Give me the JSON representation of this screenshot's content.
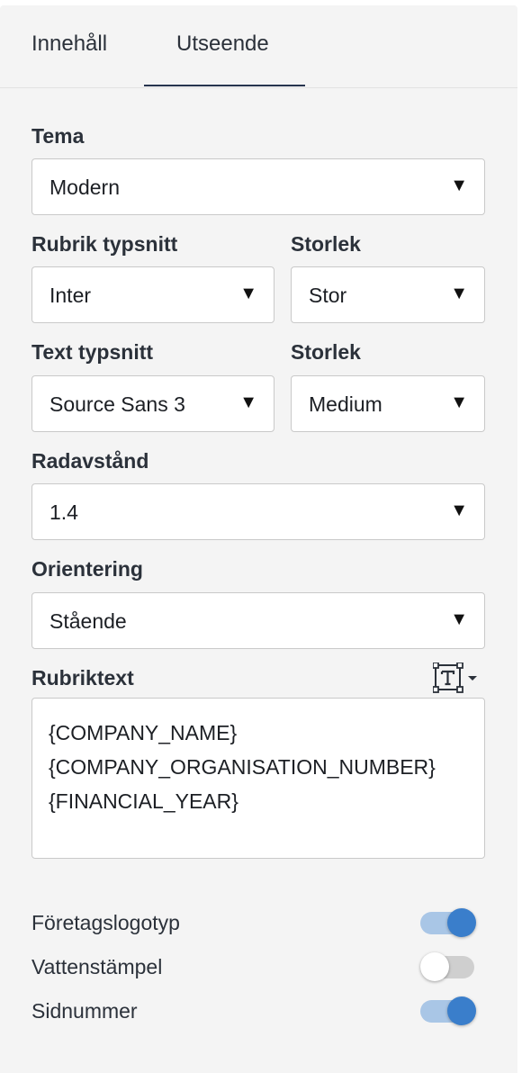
{
  "tabs": [
    {
      "label": "Innehåll",
      "active": false
    },
    {
      "label": "Utseende",
      "active": true
    }
  ],
  "theme": {
    "label": "Tema",
    "value": "Modern"
  },
  "heading_font": {
    "label": "Rubrik typsnitt",
    "value": "Inter"
  },
  "heading_size": {
    "label": "Storlek",
    "value": "Stor"
  },
  "text_font": {
    "label": "Text typsnitt",
    "value": "Source Sans 3"
  },
  "text_size": {
    "label": "Storlek",
    "value": "Medium"
  },
  "line_spacing": {
    "label": "Radavstånd",
    "value": "1.4"
  },
  "orientation": {
    "label": "Orientering",
    "value": "Stående"
  },
  "header_text": {
    "label": "Rubriktext",
    "lines": [
      "{COMPANY_NAME}",
      "{COMPANY_ORGANISATION_NUMBER}",
      "{FINANCIAL_YEAR}"
    ],
    "format_icon": "text-format-icon"
  },
  "dropdown_icon": "▼",
  "toggles": [
    {
      "label": "Företagslogotyp",
      "on": true
    },
    {
      "label": "Vattenstämpel",
      "on": false
    },
    {
      "label": "Sidnummer",
      "on": true
    }
  ],
  "colors": {
    "accent": "#3a7ecb",
    "accent_track": "#a9c6e6",
    "panel_bg": "#f4f4f4"
  }
}
